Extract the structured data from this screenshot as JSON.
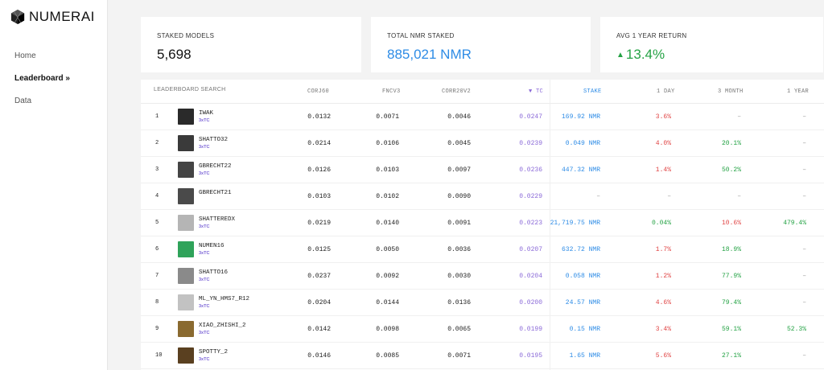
{
  "brand": "NUMERAI",
  "nav": [
    {
      "label": "Home"
    },
    {
      "label": "Leaderboard »"
    },
    {
      "label": "Data"
    }
  ],
  "stats": [
    {
      "label": "STAKED MODELS",
      "value": "5,698"
    },
    {
      "label": "TOTAL NMR STAKED",
      "value": "885,021 NMR"
    },
    {
      "label": "AVG 1 YEAR RETURN",
      "value": "13.4%",
      "icon": "triangle-up-icon"
    }
  ],
  "colors": {
    "accent_blue": "#2e8ce6",
    "accent_purple": "#8b6ad8",
    "positive": "#24a244",
    "negative": "#e04444"
  },
  "table": {
    "search_placeholder": "LEADERBOARD SEARCH",
    "headers": [
      "CORJ60",
      "FNCV3",
      "CORR20V2",
      "▼ TC",
      "STAKE",
      "1 DAY",
      "3 MONTH",
      "1 YEAR"
    ],
    "rows": [
      {
        "rank": "1",
        "name": "IWAK",
        "tag": "3xTC",
        "corj60": "0.0132",
        "fncv3": "0.0071",
        "corr20v2": "0.0046",
        "tc": "0.0247",
        "stake": "169.92 NMR",
        "d1": "3.6%",
        "m3": "–",
        "y1": "–",
        "d1c": "red",
        "m3c": "dash",
        "y1c": "dash",
        "av": "#2a2a2a"
      },
      {
        "rank": "2",
        "name": "SHATTO32",
        "tag": "3xTC",
        "corj60": "0.0214",
        "fncv3": "0.0106",
        "corr20v2": "0.0045",
        "tc": "0.0239",
        "stake": "0.049 NMR",
        "d1": "4.0%",
        "m3": "20.1%",
        "y1": "–",
        "d1c": "red",
        "m3c": "green",
        "y1c": "dash",
        "av": "#3a3a3a"
      },
      {
        "rank": "3",
        "name": "GBRECHT22",
        "tag": "3xTC",
        "corj60": "0.0126",
        "fncv3": "0.0103",
        "corr20v2": "0.0097",
        "tc": "0.0236",
        "stake": "447.32 NMR",
        "d1": "1.4%",
        "m3": "50.2%",
        "y1": "–",
        "d1c": "red",
        "m3c": "green",
        "y1c": "dash",
        "av": "#444"
      },
      {
        "rank": "4",
        "name": "GBRECHT21",
        "tag": "",
        "corj60": "0.0103",
        "fncv3": "0.0102",
        "corr20v2": "0.0090",
        "tc": "0.0229",
        "stake": "–",
        "d1": "–",
        "m3": "–",
        "y1": "–",
        "d1c": "dash",
        "m3c": "dash",
        "y1c": "dash",
        "av": "#4a4a4a"
      },
      {
        "rank": "5",
        "name": "SHATTEREDX",
        "tag": "3xTC",
        "corj60": "0.0219",
        "fncv3": "0.0140",
        "corr20v2": "0.0091",
        "tc": "0.0223",
        "stake": "21,719.75 NMR",
        "d1": "0.04%",
        "m3": "10.6%",
        "y1": "479.4%",
        "d1c": "green",
        "m3c": "red",
        "y1c": "green",
        "av": "#b5b5b5"
      },
      {
        "rank": "6",
        "name": "NUMEN16",
        "tag": "3xTC",
        "corj60": "0.0125",
        "fncv3": "0.0050",
        "corr20v2": "0.0036",
        "tc": "0.0207",
        "stake": "632.72 NMR",
        "d1": "1.7%",
        "m3": "18.9%",
        "y1": "–",
        "d1c": "red",
        "m3c": "green",
        "y1c": "dash",
        "av": "#2fa35a"
      },
      {
        "rank": "7",
        "name": "SHATTO16",
        "tag": "3xTC",
        "corj60": "0.0237",
        "fncv3": "0.0092",
        "corr20v2": "0.0030",
        "tc": "0.0204",
        "stake": "0.058 NMR",
        "d1": "1.2%",
        "m3": "77.9%",
        "y1": "–",
        "d1c": "red",
        "m3c": "green",
        "y1c": "dash",
        "av": "#8a8a8a"
      },
      {
        "rank": "8",
        "name": "ML_YN_HMS7_R12",
        "tag": "3xTC",
        "corj60": "0.0204",
        "fncv3": "0.0144",
        "corr20v2": "0.0136",
        "tc": "0.0200",
        "stake": "24.57 NMR",
        "d1": "4.6%",
        "m3": "79.4%",
        "y1": "–",
        "d1c": "red",
        "m3c": "green",
        "y1c": "dash",
        "av": "#c2c2c2"
      },
      {
        "rank": "9",
        "name": "XIAO_ZHISHI_2",
        "tag": "3xTC",
        "corj60": "0.0142",
        "fncv3": "0.0098",
        "corr20v2": "0.0065",
        "tc": "0.0199",
        "stake": "0.15 NMR",
        "d1": "3.4%",
        "m3": "59.1%",
        "y1": "52.3%",
        "d1c": "red",
        "m3c": "green",
        "y1c": "green",
        "av": "#8a6a30"
      },
      {
        "rank": "10",
        "name": "SPOTTY_2",
        "tag": "3xTC",
        "corj60": "0.0146",
        "fncv3": "0.0085",
        "corr20v2": "0.0071",
        "tc": "0.0195",
        "stake": "1.65 NMR",
        "d1": "5.6%",
        "m3": "27.1%",
        "y1": "–",
        "d1c": "red",
        "m3c": "green",
        "y1c": "dash",
        "av": "#5a4020"
      }
    ]
  }
}
